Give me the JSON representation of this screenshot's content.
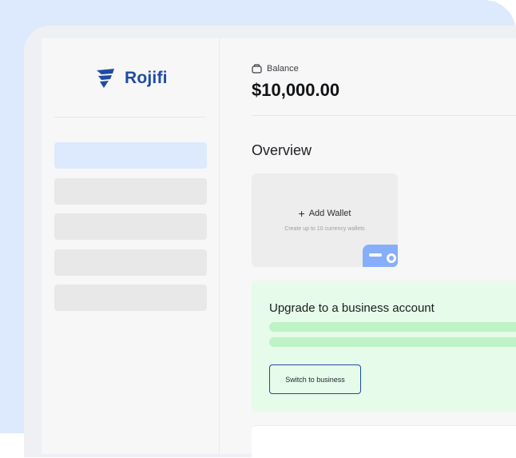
{
  "brand": {
    "name": "Rojifi"
  },
  "balance": {
    "label": "Balance",
    "value": "$10,000.00"
  },
  "overview": {
    "title": "Overview"
  },
  "wallet": {
    "title": "Add Wallet",
    "subtitle": "Create up to 10 currency wallets"
  },
  "upgrade": {
    "title": "Upgrade to a business account",
    "button_label": "Switch to business"
  },
  "colors": {
    "brand": "#1f4ba3",
    "accent_blue": "#dde9fc",
    "success_bg": "#e6fbe9",
    "success_bar": "#bdf3c6"
  }
}
